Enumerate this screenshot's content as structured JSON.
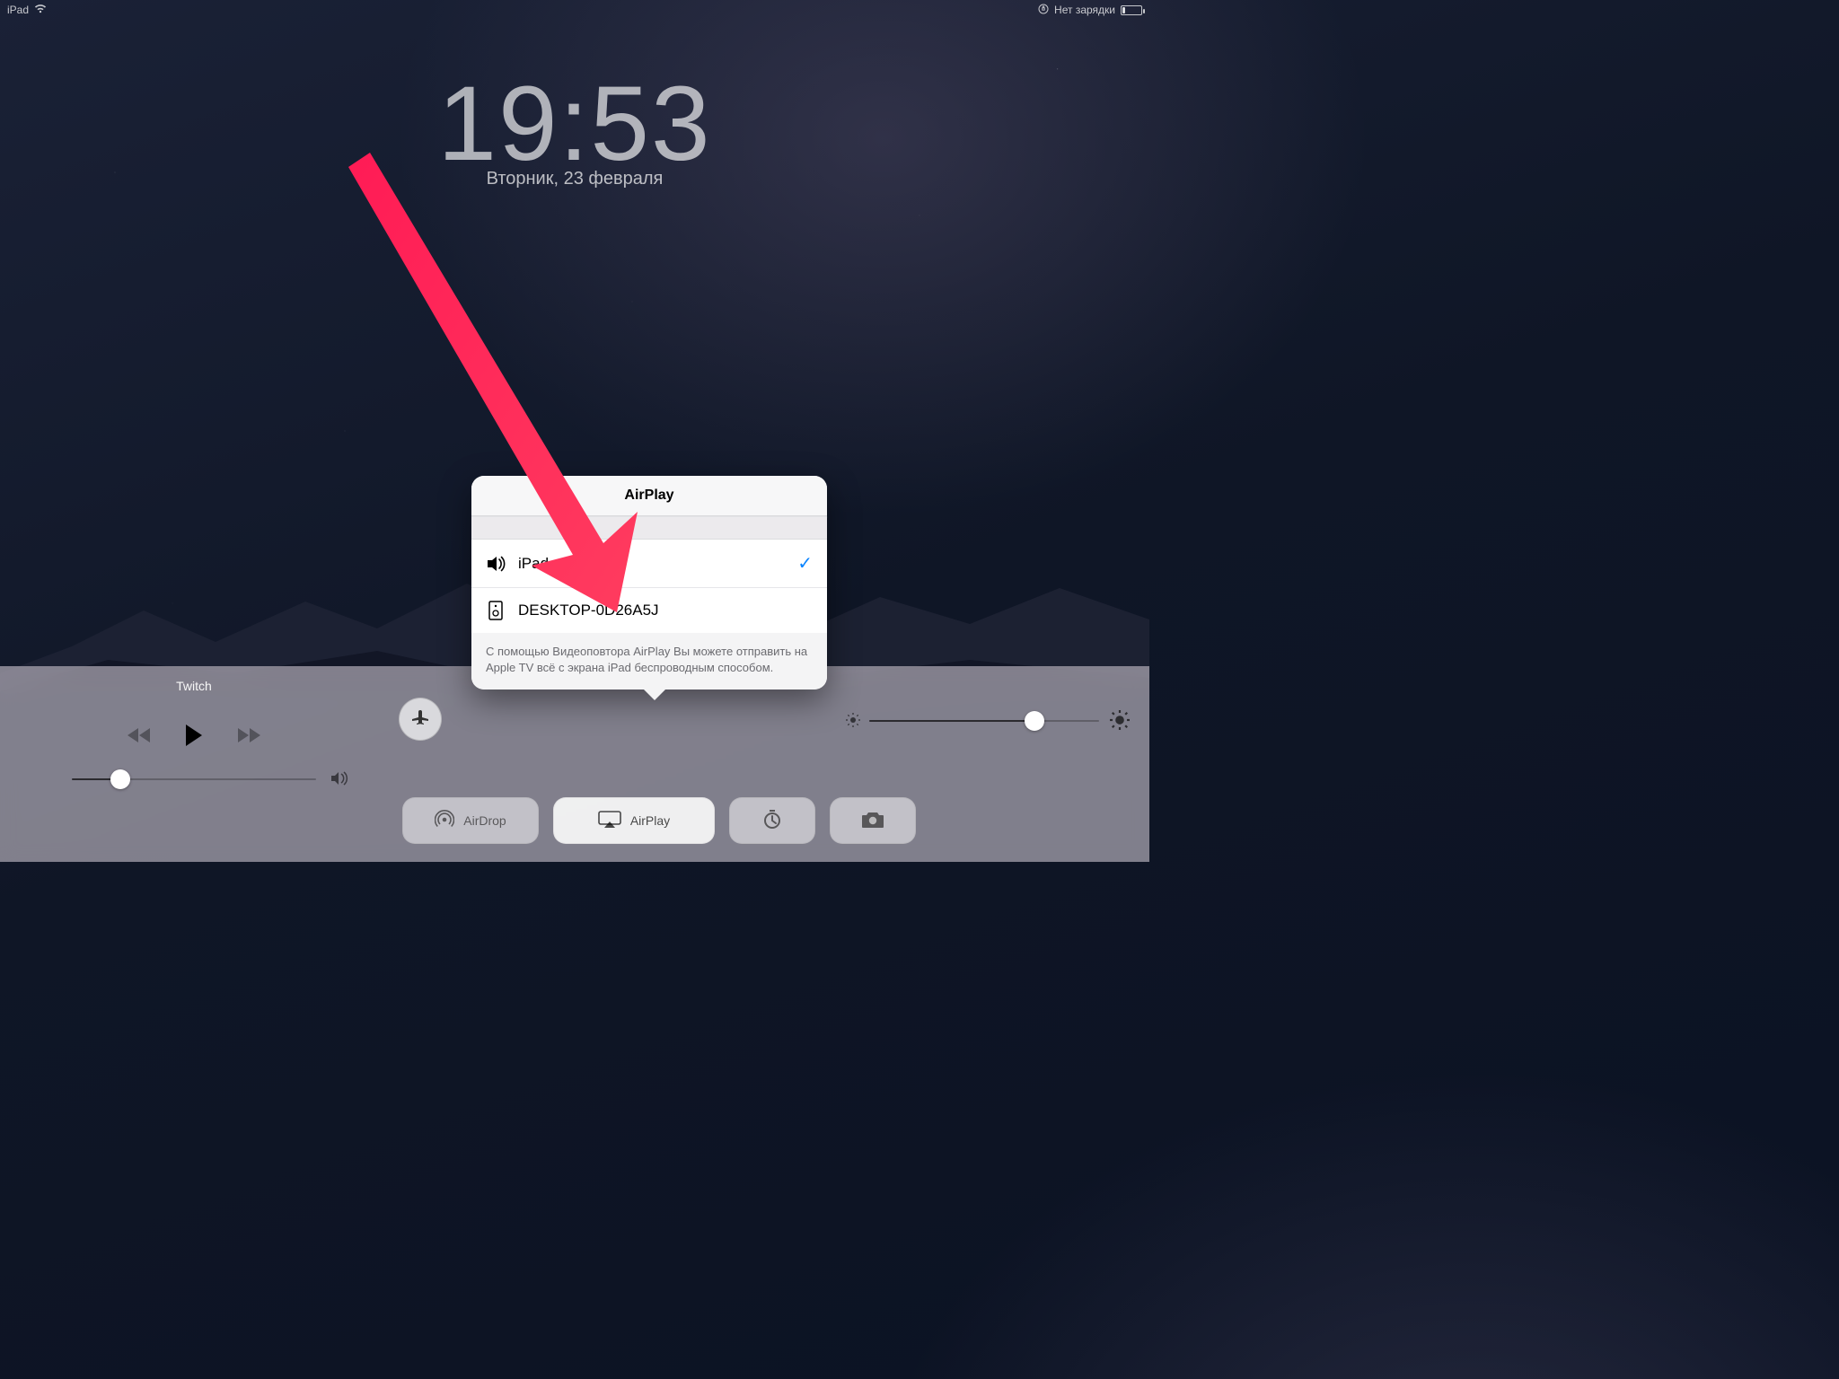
{
  "status": {
    "device": "iPad",
    "battery_text": "Нет зарядки"
  },
  "lockscreen": {
    "time": "19:53",
    "date": "Вторник, 23 февраля"
  },
  "popover": {
    "title": "AirPlay",
    "items": [
      {
        "icon": "speaker",
        "label": "iPad",
        "selected": true
      },
      {
        "icon": "device",
        "label": "DESKTOP-0D26A5J",
        "selected": false
      }
    ],
    "footer": "С помощью Видеоповтора AirPlay Вы можете отправить на Apple TV всё с экрана iPad беспроводным способом."
  },
  "control_center": {
    "media_title": "Twitch",
    "buttons": {
      "airdrop": "AirDrop",
      "airplay": "AirPlay"
    }
  },
  "annotation": {
    "color": "#ff1b55"
  }
}
